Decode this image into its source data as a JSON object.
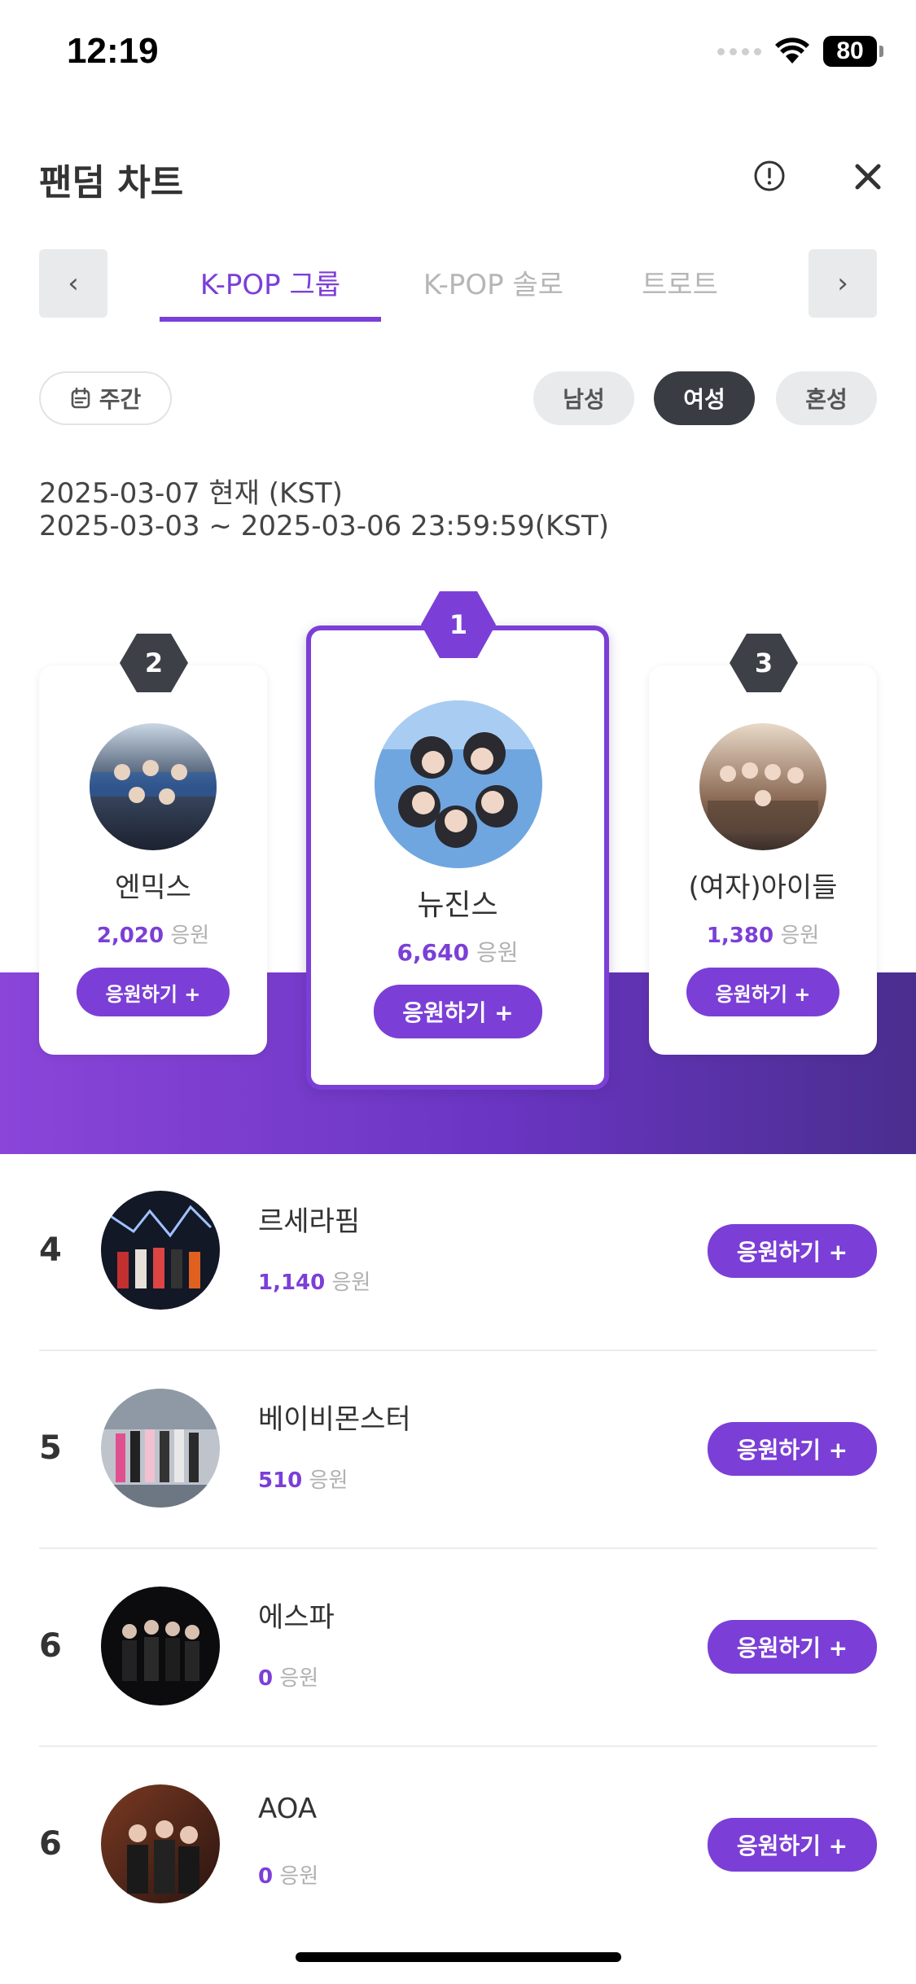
{
  "status_bar": {
    "time": "12:19",
    "battery": "80"
  },
  "header": {
    "title": "팬덤 차트"
  },
  "category_tabs": [
    {
      "label": "K-POP 그룹",
      "active": true
    },
    {
      "label": "K-POP 솔로",
      "active": false
    },
    {
      "label": "트로트",
      "active": false
    }
  ],
  "nav": {
    "prev": "‹",
    "next": "›"
  },
  "period": {
    "label": "주간"
  },
  "gender_filters": [
    {
      "label": "남성",
      "active": false
    },
    {
      "label": "여성",
      "active": true
    },
    {
      "label": "혼성",
      "active": false
    }
  ],
  "dates": {
    "current": "2025-03-07 현재 (KST)",
    "range": "2025-03-03 ~ 2025-03-06 23:59:59(KST)"
  },
  "vote_label": "응원하기 +",
  "unit_label": "응원",
  "podium": [
    {
      "rank": "1",
      "name": "뉴진스",
      "count": "6,640"
    },
    {
      "rank": "2",
      "name": "엔믹스",
      "count": "2,020"
    },
    {
      "rank": "3",
      "name": "(여자)아이들",
      "count": "1,380"
    }
  ],
  "list": [
    {
      "rank": "4",
      "name": "르세라핌",
      "count": "1,140"
    },
    {
      "rank": "5",
      "name": "베이비몬스터",
      "count": "510"
    },
    {
      "rank": "6",
      "name": "에스파",
      "count": "0"
    },
    {
      "rank": "6",
      "name": "AOA",
      "count": "0"
    }
  ],
  "colors": {
    "accent": "#7b3fd7",
    "dark_badge": "#3e4048",
    "band_start": "#8a45d9",
    "band_end": "#4a2e8f"
  }
}
